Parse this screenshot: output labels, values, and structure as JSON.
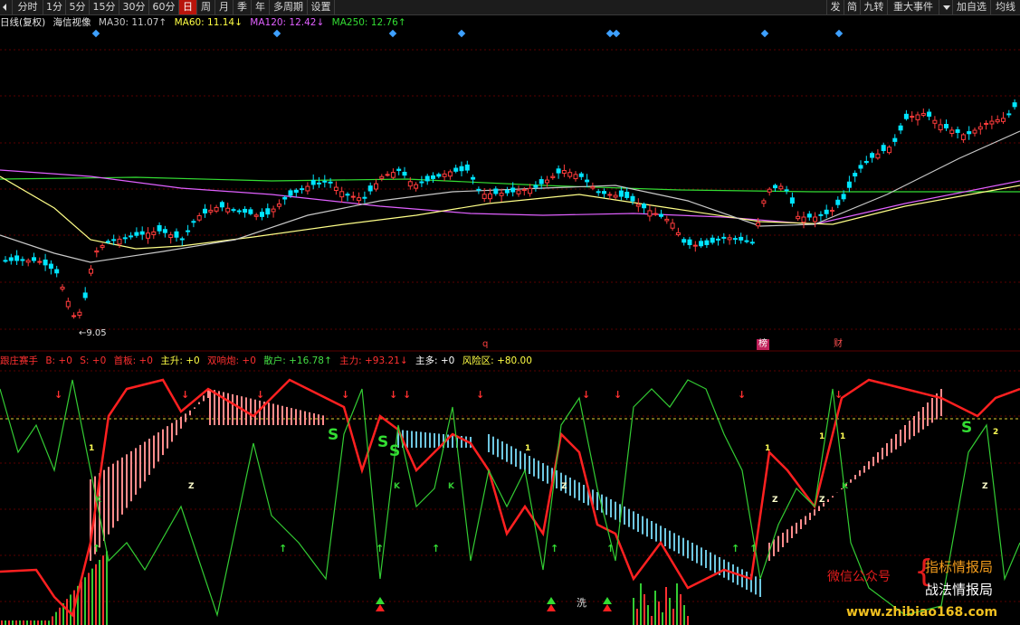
{
  "toolbar": {
    "left": [
      {
        "label": "分时",
        "active": false
      },
      {
        "label": "1分",
        "active": false
      },
      {
        "label": "5分",
        "active": false
      },
      {
        "label": "15分",
        "active": false
      },
      {
        "label": "30分",
        "active": false
      },
      {
        "label": "60分",
        "active": false
      },
      {
        "label": "日",
        "active": true
      },
      {
        "label": "周",
        "active": false
      },
      {
        "label": "月",
        "active": false
      },
      {
        "label": "季",
        "active": false
      },
      {
        "label": "年",
        "active": false
      },
      {
        "label": "多周期",
        "active": false
      },
      {
        "label": "设置",
        "active": false
      }
    ],
    "right": [
      "发",
      "简",
      "九转",
      "重大事件",
      "",
      "加自选",
      "均线"
    ]
  },
  "price_panel": {
    "period": "日线(复权)",
    "stock_name": "海信视像",
    "ma30": {
      "label": "MA30: 11.07↑",
      "color": "#c8c8c8"
    },
    "ma60": {
      "label": "MA60: 11.14↓",
      "color": "#ffff44"
    },
    "ma120": {
      "label": "MA120: 12.42↓",
      "color": "#e060ff"
    },
    "ma250": {
      "label": "MA250: 12.76↑",
      "color": "#33dd33"
    },
    "low_label": "←9.05",
    "markers": {
      "q": "q",
      "bang": "榜",
      "cai": "财"
    }
  },
  "indicator_panel": {
    "items": [
      {
        "label": "跟庄赛手",
        "color": "#ff3030"
      },
      {
        "label": "B: +0",
        "color": "#ff3030"
      },
      {
        "label": "S: +0",
        "color": "#ff3030"
      },
      {
        "label": "首板: +0",
        "color": "#ff3030"
      },
      {
        "label": "主升: +0",
        "color": "#ffff44"
      },
      {
        "label": "双响炮: +0",
        "color": "#ff3030"
      },
      {
        "label": "散户: +16.78↑",
        "color": "#44dd44"
      },
      {
        "label": "主力: +93.21↓",
        "color": "#ff3030"
      },
      {
        "label": "主多: +0",
        "color": "#ffffff"
      },
      {
        "label": "风险区: +80.00",
        "color": "#ffff44"
      }
    ],
    "xi_label": "洗"
  },
  "watermark": {
    "wechat": "微信公众号",
    "brace": "{",
    "name1": "指标情报局",
    "name2": "战法情报局",
    "url": "www.zhibiao168.com"
  },
  "colors": {
    "up": "#ff3c3c",
    "down": "#00e5ff",
    "grid": "#5a0000",
    "bg": "#000000"
  }
}
